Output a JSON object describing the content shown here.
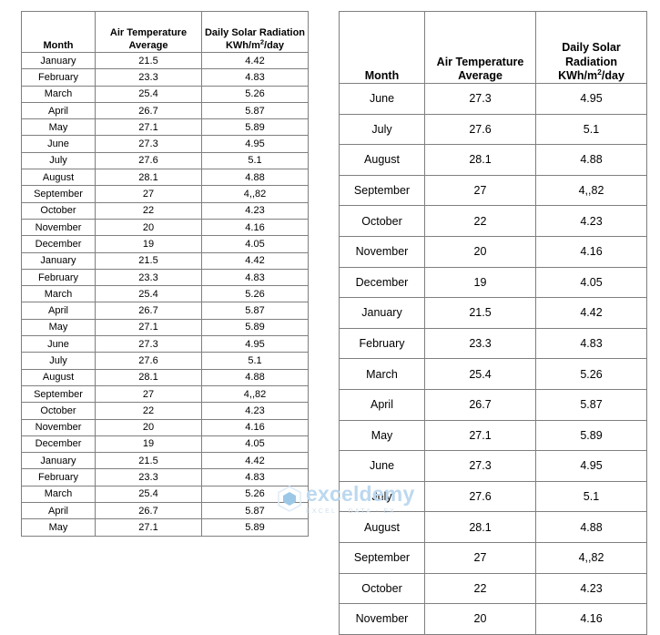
{
  "document": {
    "type": "spreadsheet-tables-screenshot",
    "background_color": "#ffffff",
    "border_color": "#7f7f7f"
  },
  "columns": {
    "month": "Month",
    "air_temperature_line1": "Air Temperature",
    "air_temperature_line2": "Average",
    "solar_line1": "Daily Solar Radiation",
    "solar_line2_prefix": "KWh/m",
    "solar_line2_sup": "2",
    "solar_line2_suffix": "/day"
  },
  "left_table": {
    "name": "compact-monthly-table",
    "rows": [
      {
        "month": "January",
        "temperature": "21.5",
        "solar": "4.42"
      },
      {
        "month": "February",
        "temperature": "23.3",
        "solar": "4.83"
      },
      {
        "month": "March",
        "temperature": "25.4",
        "solar": "5.26"
      },
      {
        "month": "April",
        "temperature": "26.7",
        "solar": "5.87"
      },
      {
        "month": "May",
        "temperature": "27.1",
        "solar": "5.89"
      },
      {
        "month": "June",
        "temperature": "27.3",
        "solar": "4.95"
      },
      {
        "month": "July",
        "temperature": "27.6",
        "solar": "5.1"
      },
      {
        "month": "August",
        "temperature": "28.1",
        "solar": "4.88"
      },
      {
        "month": "September",
        "temperature": "27",
        "solar": "4,,82"
      },
      {
        "month": "October",
        "temperature": "22",
        "solar": "4.23"
      },
      {
        "month": "November",
        "temperature": "20",
        "solar": "4.16"
      },
      {
        "month": "December",
        "temperature": "19",
        "solar": "4.05"
      },
      {
        "month": "January",
        "temperature": "21.5",
        "solar": "4.42"
      },
      {
        "month": "February",
        "temperature": "23.3",
        "solar": "4.83"
      },
      {
        "month": "March",
        "temperature": "25.4",
        "solar": "5.26"
      },
      {
        "month": "April",
        "temperature": "26.7",
        "solar": "5.87"
      },
      {
        "month": "May",
        "temperature": "27.1",
        "solar": "5.89"
      },
      {
        "month": "June",
        "temperature": "27.3",
        "solar": "4.95"
      },
      {
        "month": "July",
        "temperature": "27.6",
        "solar": "5.1"
      },
      {
        "month": "August",
        "temperature": "28.1",
        "solar": "4.88"
      },
      {
        "month": "September",
        "temperature": "27",
        "solar": "4,,82"
      },
      {
        "month": "October",
        "temperature": "22",
        "solar": "4.23"
      },
      {
        "month": "November",
        "temperature": "20",
        "solar": "4.16"
      },
      {
        "month": "December",
        "temperature": "19",
        "solar": "4.05"
      },
      {
        "month": "January",
        "temperature": "21.5",
        "solar": "4.42"
      },
      {
        "month": "February",
        "temperature": "23.3",
        "solar": "4.83"
      },
      {
        "month": "March",
        "temperature": "25.4",
        "solar": "5.26"
      },
      {
        "month": "April",
        "temperature": "26.7",
        "solar": "5.87"
      },
      {
        "month": "May",
        "temperature": "27.1",
        "solar": "5.89"
      }
    ]
  },
  "right_table": {
    "name": "expanded-monthly-table",
    "rows": [
      {
        "month": "June",
        "temperature": "27.3",
        "solar": "4.95"
      },
      {
        "month": "July",
        "temperature": "27.6",
        "solar": "5.1"
      },
      {
        "month": "August",
        "temperature": "28.1",
        "solar": "4.88"
      },
      {
        "month": "September",
        "temperature": "27",
        "solar": "4,,82"
      },
      {
        "month": "October",
        "temperature": "22",
        "solar": "4.23"
      },
      {
        "month": "November",
        "temperature": "20",
        "solar": "4.16"
      },
      {
        "month": "December",
        "temperature": "19",
        "solar": "4.05"
      },
      {
        "month": "January",
        "temperature": "21.5",
        "solar": "4.42"
      },
      {
        "month": "February",
        "temperature": "23.3",
        "solar": "4.83"
      },
      {
        "month": "March",
        "temperature": "25.4",
        "solar": "5.26"
      },
      {
        "month": "April",
        "temperature": "26.7",
        "solar": "5.87"
      },
      {
        "month": "May",
        "temperature": "27.1",
        "solar": "5.89"
      },
      {
        "month": "June",
        "temperature": "27.3",
        "solar": "4.95"
      },
      {
        "month": "July",
        "temperature": "27.6",
        "solar": "5.1"
      },
      {
        "month": "August",
        "temperature": "28.1",
        "solar": "4.88"
      },
      {
        "month": "September",
        "temperature": "27",
        "solar": "4,,82"
      },
      {
        "month": "October",
        "temperature": "22",
        "solar": "4.23"
      },
      {
        "month": "November",
        "temperature": "20",
        "solar": "4.16"
      }
    ]
  },
  "watermark": {
    "name": "exceldemy",
    "tagline": "EXCEL - DATA - EX",
    "color": "#bcd8ef",
    "logo_icon": "hexagon-logo-icon"
  }
}
